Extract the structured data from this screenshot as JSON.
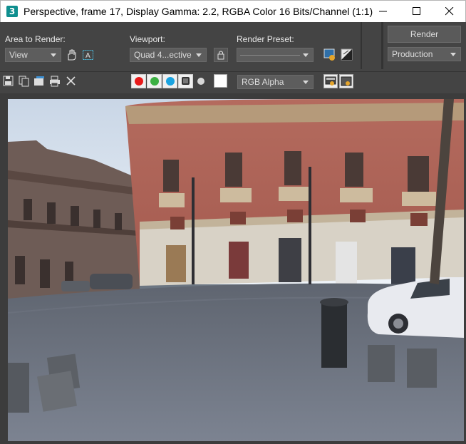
{
  "window": {
    "title": "Perspective, frame 17, Display Gamma: 2.2, RGBA Color 16 Bits/Channel (1:1)",
    "app_icon_text": "3"
  },
  "toolbar": {
    "area_to_render_label": "Area to Render:",
    "area_to_render_value": "View",
    "viewport_label": "Viewport:",
    "viewport_value": "Quad 4...ective",
    "render_preset_label": "Render Preset:",
    "render_preset_value": "",
    "render_button": "Render",
    "production_value": "Production"
  },
  "toolbar2": {
    "channel_value": "RGB Alpha",
    "channel_colors": {
      "red": "#e81a1a",
      "green": "#3cb043",
      "blue": "#1aa3e0"
    }
  }
}
